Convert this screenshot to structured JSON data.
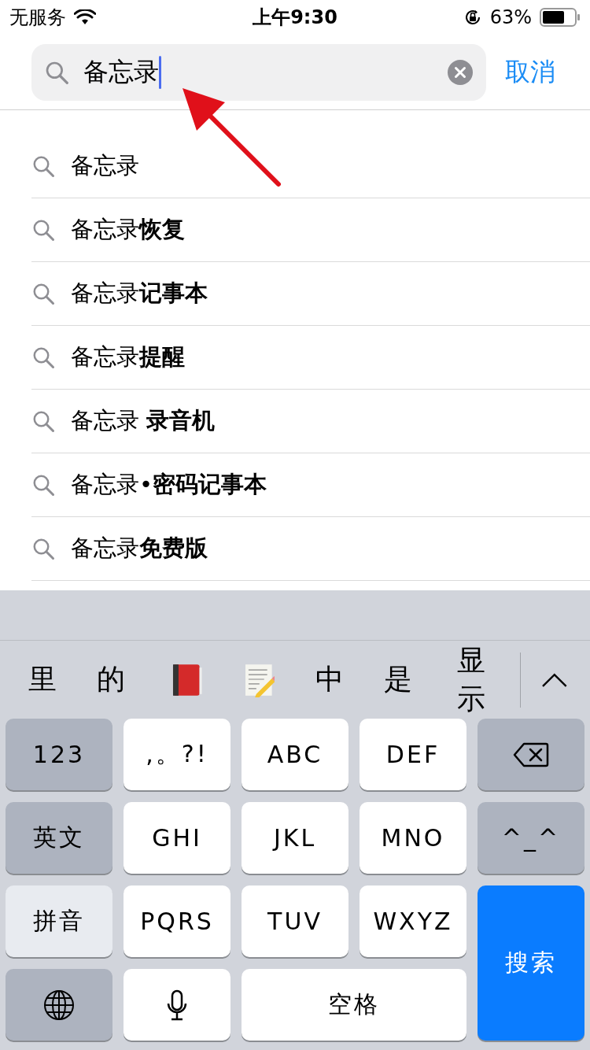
{
  "status_bar": {
    "carrier": "无服务",
    "time": "上午9:30",
    "battery": "63%"
  },
  "search": {
    "value": "备忘录",
    "cancel": "取消"
  },
  "suggestions": [
    {
      "text": "备忘录"
    },
    {
      "text": "备忘录**恢复**"
    },
    {
      "text": "备忘录**记事本**"
    },
    {
      "text": "备忘录**提醒**"
    },
    {
      "text": "备忘录 **录音机**"
    },
    {
      "text": "备忘录•**密码记事本**"
    },
    {
      "text": "备忘录**免费版**"
    }
  ],
  "candidates": [
    {
      "kind": "text",
      "label": "里"
    },
    {
      "kind": "text",
      "label": "的"
    },
    {
      "kind": "book"
    },
    {
      "kind": "memo"
    },
    {
      "kind": "text",
      "label": "中"
    },
    {
      "kind": "text",
      "label": "是"
    },
    {
      "kind": "text",
      "label": "显示"
    }
  ],
  "keys": [
    {
      "kind": "mode",
      "label": "123",
      "selected": false
    },
    {
      "kind": "letter",
      "label": ",。?!"
    },
    {
      "kind": "letter",
      "label": "ABC"
    },
    {
      "kind": "letter",
      "label": "DEF"
    },
    {
      "kind": "delete"
    },
    {
      "kind": "mode",
      "label": "英文",
      "selected": false
    },
    {
      "kind": "letter",
      "label": "GHI"
    },
    {
      "kind": "letter",
      "label": "JKL"
    },
    {
      "kind": "letter",
      "label": "MNO"
    },
    {
      "kind": "function",
      "label": "^_^"
    },
    {
      "kind": "mode",
      "label": "拼音",
      "selected": true
    },
    {
      "kind": "letter",
      "label": "PQRS"
    },
    {
      "kind": "letter",
      "label": "TUV"
    },
    {
      "kind": "letter",
      "label": "WXYZ"
    },
    {
      "kind": "search",
      "label": "搜索"
    },
    {
      "kind": "globe"
    },
    {
      "kind": "mic"
    },
    {
      "kind": "space",
      "label": "空格"
    }
  ]
}
